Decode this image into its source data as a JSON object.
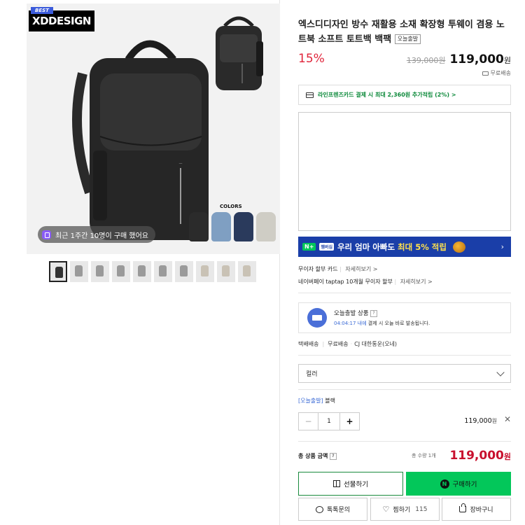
{
  "gallery": {
    "best_tag": "BEST",
    "brand_logo": "XDDESIGN",
    "colors_label": "COLORS",
    "swatch_colors": [
      "#2b2b2b",
      "#7f9fc2",
      "#2a3a5c",
      "#cfcdc5"
    ],
    "notice": "최근 1주간 10명이 구매 했어요",
    "thumbnail_count": 11
  },
  "product": {
    "title": "엑스디디자인 방수 재활용 소재 확장형 투웨이 겸용 노트북 소프트 토트백 백팩",
    "title_badge": "오늘출발",
    "discount": "15%",
    "original_price": "139,000원",
    "price_value": "119,000",
    "price_unit": "원",
    "shipping": "무료배송"
  },
  "card_banner": {
    "text": "라인프렌즈카드 결제 시 최대 2,360원 추가적립 (2%) >"
  },
  "npay_banner": {
    "logo": "N+",
    "small_label": "멤버십",
    "text_prefix": "우리 엄마 아빠도 ",
    "text_highlight": "최대 5% 적립",
    "arrow": "›"
  },
  "benefits": {
    "line1": "무이자 할부 카드",
    "line1_more": "자세히보기 >",
    "line2": "네이버페이 taptap 10개월 무이자 할부",
    "line2_more": "자세히보기 >"
  },
  "today_delivery": {
    "title": "오늘출발 상품",
    "help": "?",
    "time": "04:04:17 내에",
    "sub": " 결제 시 오늘 바로 발송됩니다."
  },
  "shipping_info": {
    "type": "택배배송",
    "fee": "무료배송",
    "courier": "CJ 대한통운(오네)"
  },
  "option_select": {
    "label": "컬러"
  },
  "selected_option": {
    "badge": "[오늘출발]",
    "name": " 블랙",
    "quantity": "1",
    "minus": "−",
    "plus": "+",
    "price": "119,000",
    "price_unit": "원",
    "remove": "✕"
  },
  "total": {
    "label": "총 상품 금액",
    "help": "?",
    "quantity_text": "총 수량 1개",
    "price": "119,000",
    "unit": "원"
  },
  "buttons": {
    "gift": "선물하기",
    "buy": "구매하기",
    "talk": "톡톡문의",
    "wish": "찜하기",
    "wish_count": "115",
    "cart": "장바구니"
  },
  "colors": {
    "discount_red": "#e0243a",
    "naver_green": "#03c75a",
    "npay_blue": "#1a3ea8",
    "total_red": "#c8102e"
  }
}
